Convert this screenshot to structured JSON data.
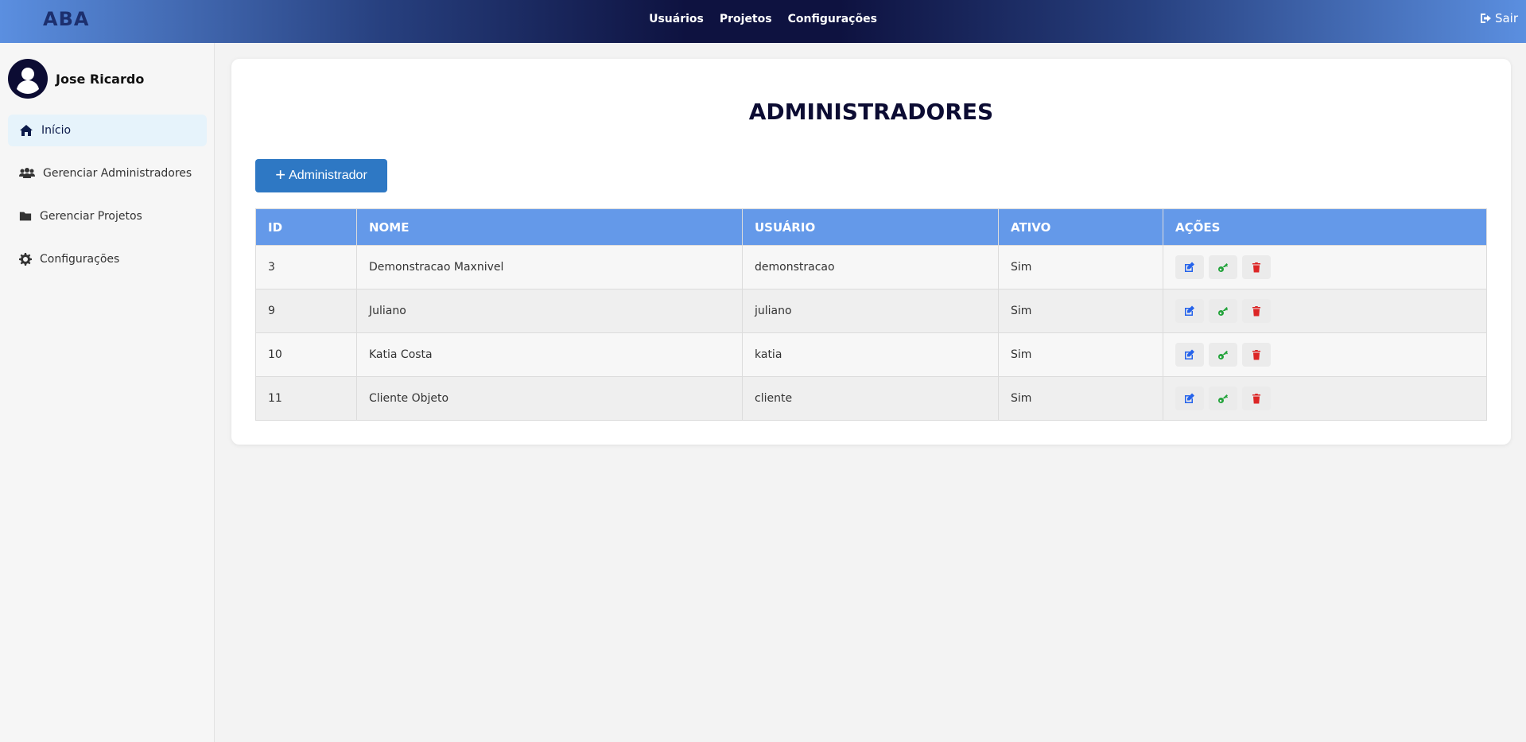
{
  "header": {
    "logo": "ABA",
    "nav": [
      "Usuários",
      "Projetos",
      "Configurações"
    ],
    "logout": "Sair"
  },
  "sidebar": {
    "user_name": "Jose Ricardo",
    "items": [
      {
        "label": "Início",
        "icon": "home-icon"
      },
      {
        "label": "Gerenciar Administradores",
        "icon": "users-icon"
      },
      {
        "label": "Gerenciar Projetos",
        "icon": "folder-icon"
      },
      {
        "label": "Configurações",
        "icon": "gear-icon"
      }
    ]
  },
  "main": {
    "title": "ADMINISTRADORES",
    "add_button_label": "Administrador",
    "table": {
      "headers": [
        "ID",
        "NOME",
        "USUÁRIO",
        "ATIVO",
        "AÇÕES"
      ],
      "rows": [
        {
          "id": "3",
          "nome": "Demonstracao Maxnivel",
          "usuario": "demonstracao",
          "ativo": "Sim"
        },
        {
          "id": "9",
          "nome": "Juliano",
          "usuario": "juliano",
          "ativo": "Sim"
        },
        {
          "id": "10",
          "nome": "Katia Costa",
          "usuario": "katia",
          "ativo": "Sim"
        },
        {
          "id": "11",
          "nome": "Cliente Objeto",
          "usuario": "cliente",
          "ativo": "Sim"
        }
      ]
    }
  },
  "colors": {
    "edit": "#2563eb",
    "key": "#22a33a",
    "delete": "#dc2626",
    "header_bg": "#6499e9",
    "button_bg": "#2e78c4"
  }
}
